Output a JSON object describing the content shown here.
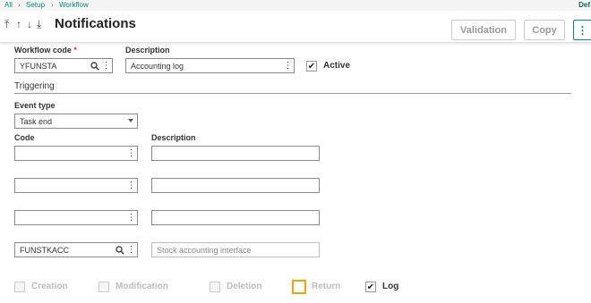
{
  "breadcrumb": [
    "All",
    "Setup",
    "Workflow"
  ],
  "topbar_right": "Def",
  "nav": {
    "first": "⤒",
    "prev": "↑",
    "next": "↓",
    "last": "⤓"
  },
  "page_title": "Notifications",
  "toolbar": {
    "validation_label": "Validation",
    "copy_label": "Copy",
    "menu_icon": "⋮"
  },
  "workflow_code": {
    "label": "Workflow code",
    "required_mark": "*",
    "value": "YFUNSTA"
  },
  "description": {
    "label": "Description",
    "value": "Accounting log"
  },
  "active": {
    "label": "Active",
    "checked": true
  },
  "triggering": {
    "section_title": "Triggering",
    "event_type": {
      "label": "Event type",
      "value": "Task end"
    },
    "code_header": "Code",
    "description_header": "Description",
    "rows": [
      {
        "code": "",
        "description": ""
      },
      {
        "code": "",
        "description": ""
      },
      {
        "code": "",
        "description": ""
      },
      {
        "code": "FUNSTKACC",
        "description": "Stock accounting interface"
      }
    ]
  },
  "options": {
    "creation": {
      "label": "Creation",
      "checked": false,
      "enabled": false
    },
    "modification": {
      "label": "Modification",
      "checked": false,
      "enabled": false
    },
    "deletion": {
      "label": "Deletion",
      "checked": false,
      "enabled": false
    },
    "return": {
      "label": "Return",
      "checked": false,
      "enabled": false
    },
    "log": {
      "label": "Log",
      "checked": true,
      "enabled": true
    }
  },
  "icons": {
    "search": "search-icon",
    "more": "more-vertical-icon",
    "check": "✔"
  },
  "colors": {
    "accent": "#008f7a",
    "required": "#d33333",
    "focus": "#f0a500"
  }
}
